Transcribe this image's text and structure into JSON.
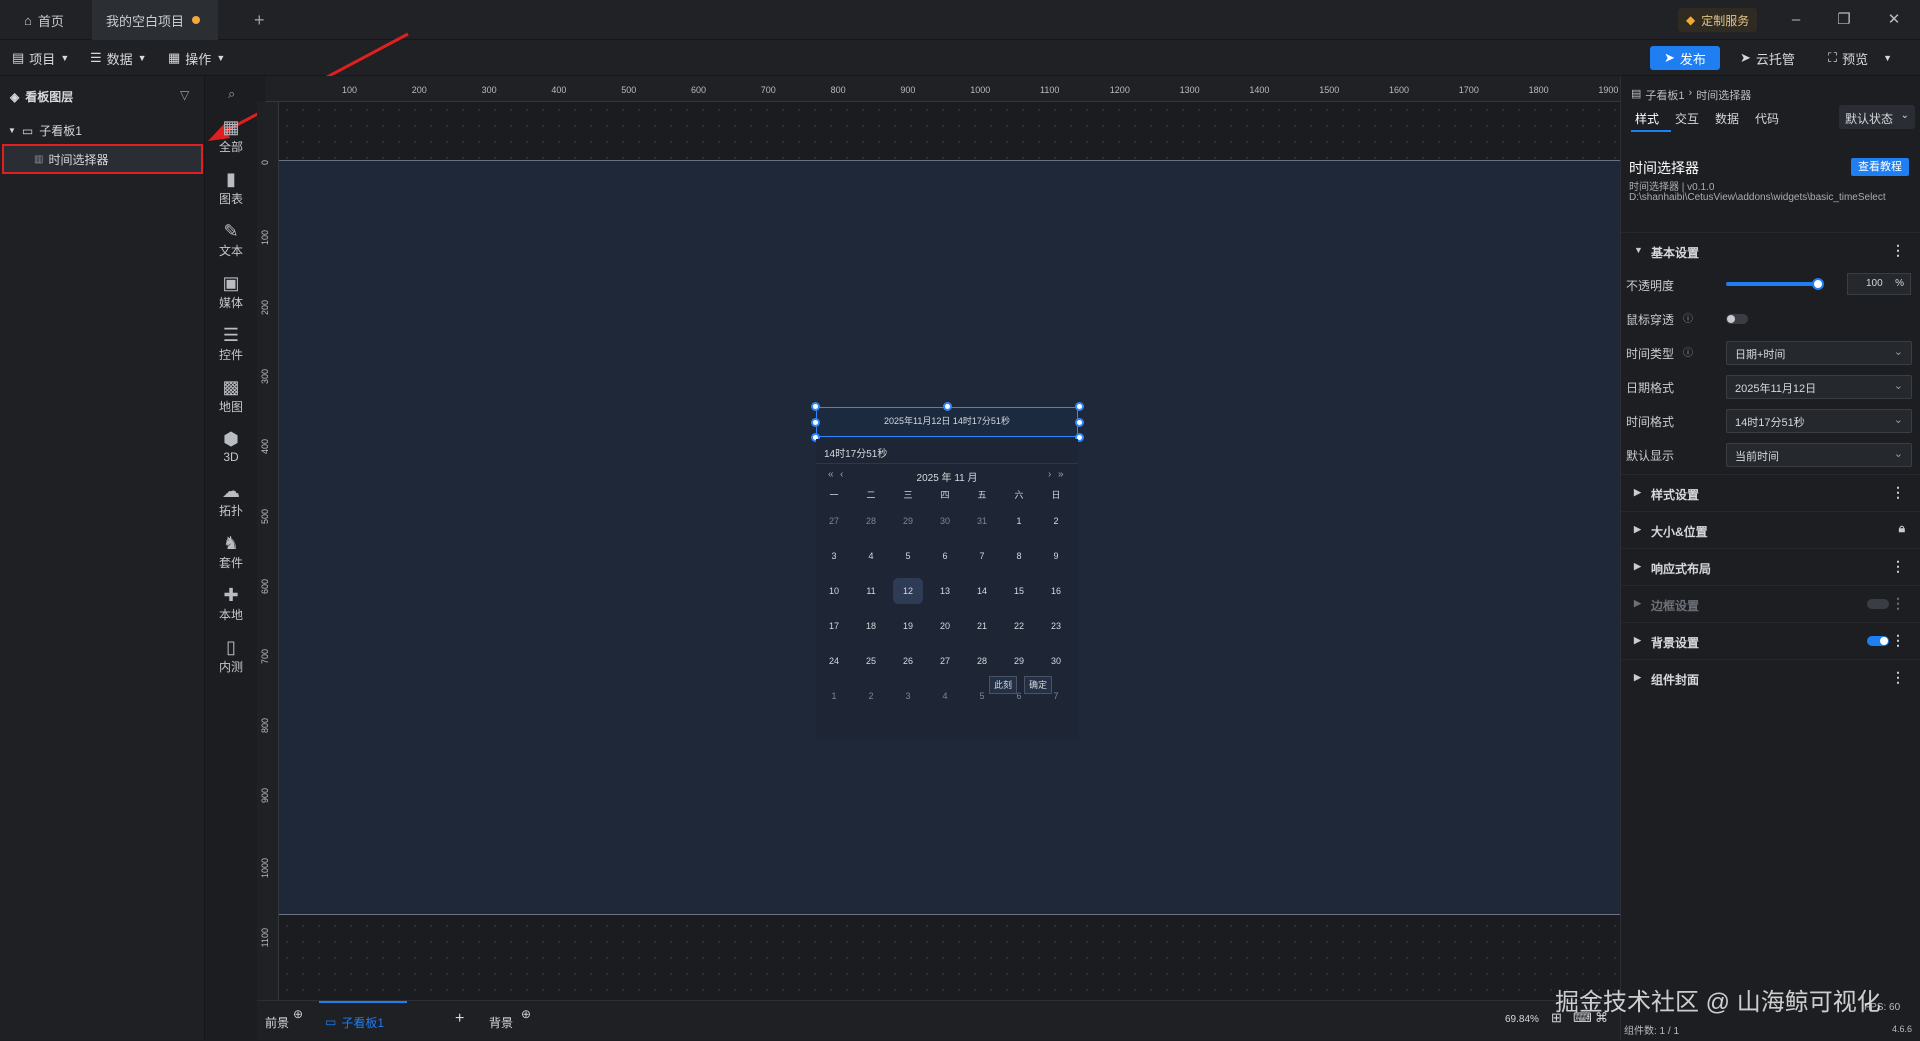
{
  "titlebar": {
    "home_tab": "首页",
    "project_tab": "我的空白项目",
    "new_tab": "+",
    "custom_service": "定制服务"
  },
  "menubar": {
    "project": "项目",
    "data": "数据",
    "operate": "操作",
    "publish": "发布",
    "cloud_host": "云托管",
    "preview": "预览"
  },
  "layers": {
    "title": "看板图层",
    "sub_board": "子看板1",
    "item": "时间选择器"
  },
  "toolbox": [
    {
      "label": "全部",
      "icon": "grid-icon"
    },
    {
      "label": "图表",
      "icon": "bar-chart-icon"
    },
    {
      "label": "文本",
      "icon": "text-icon"
    },
    {
      "label": "媒体",
      "icon": "media-icon"
    },
    {
      "label": "控件",
      "icon": "control-icon"
    },
    {
      "label": "地图",
      "icon": "map-icon"
    },
    {
      "label": "3D",
      "icon": "cube-icon"
    },
    {
      "label": "拓扑",
      "icon": "topology-icon"
    },
    {
      "label": "套件",
      "icon": "kit-icon"
    },
    {
      "label": "本地",
      "icon": "puzzle-icon"
    },
    {
      "label": "内测",
      "icon": "beta-icon"
    }
  ],
  "ruler_top": [
    "100",
    "200",
    "300",
    "400",
    "500",
    "600",
    "700",
    "800",
    "900",
    "1000",
    "1100",
    "1200",
    "1300",
    "1400",
    "1500",
    "1600",
    "1700",
    "1800",
    "1900"
  ],
  "ruler_left": [
    "0",
    "100",
    "200",
    "300",
    "400",
    "500",
    "600",
    "700",
    "800",
    "900",
    "1000",
    "1100"
  ],
  "widget": {
    "input_text": "2025年11月12日 14时17分51秒",
    "time_text": "14时17分51秒",
    "year_month": "2025 年  11 月",
    "weekdays": [
      "一",
      "二",
      "三",
      "四",
      "五",
      "六",
      "日"
    ],
    "weeks": [
      [
        "27",
        "28",
        "29",
        "30",
        "31",
        "1",
        "2"
      ],
      [
        "3",
        "4",
        "5",
        "6",
        "7",
        "8",
        "9"
      ],
      [
        "10",
        "11",
        "12",
        "13",
        "14",
        "15",
        "16"
      ],
      [
        "17",
        "18",
        "19",
        "20",
        "21",
        "22",
        "23"
      ],
      [
        "24",
        "25",
        "26",
        "27",
        "28",
        "29",
        "30"
      ],
      [
        "1",
        "2",
        "3",
        "4",
        "5",
        "6",
        "7"
      ]
    ],
    "selected_day": "12",
    "now_button": "此刻",
    "confirm_button": "确定"
  },
  "inspector": {
    "breadcrumb_parent": "子看板1",
    "breadcrumb_current": "时间选择器",
    "tabs": [
      "样式",
      "交互",
      "数据",
      "代码"
    ],
    "state": "默认状态",
    "title": "时间选择器",
    "tutorial": "查看教程",
    "version": "时间选择器 | v0.1.0",
    "path": "D:\\shanhaibi\\CetusView\\addons\\widgets\\basic_timeSelect",
    "basic_section": "基本设置",
    "opacity_label": "不透明度",
    "opacity_value": "100",
    "opacity_unit": "%",
    "opacity_fraction": 1.0,
    "mouse_through_label": "鼠标穿透",
    "time_type_label": "时间类型",
    "time_type_value": "日期+时间",
    "date_format_label": "日期格式",
    "date_format_value": "2025年11月12日",
    "time_format_label": "时间格式",
    "time_format_value": "14时17分51秒",
    "default_display_label": "默认显示",
    "default_display_value": "当前时间",
    "sections": [
      "样式设置",
      "大小&位置",
      "响应式布局",
      "边框设置",
      "背景设置",
      "组件封面"
    ]
  },
  "bottombar": {
    "front": "前景",
    "sub_board": "子看板1",
    "back": "背景",
    "zoom": "69.84%",
    "components": "组件数: 1 / 1",
    "fps": "FPS: 60",
    "version": "4.6.6"
  },
  "watermark": "掘金技术社区 @ 山海鲸可视化",
  "colors": {
    "accent": "#1e7ef2",
    "highlight": "#e02020",
    "board": "#1f2838"
  }
}
